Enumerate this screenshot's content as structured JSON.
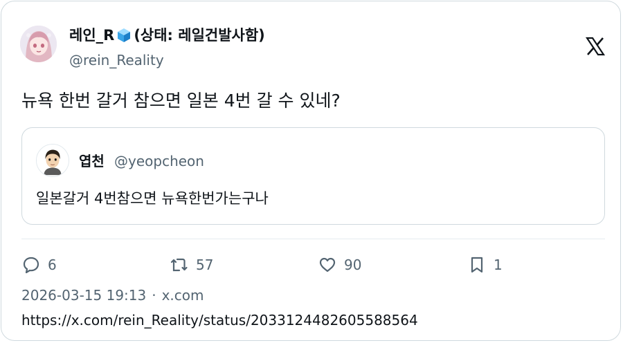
{
  "author": {
    "display_name_prefix": "레인_R",
    "display_name_suffix": "(상태: 레일건발사함)",
    "handle": "@rein_Reality",
    "avatar_icon": "anime-girl-avatar",
    "badge_icon": "blue-cube-icon"
  },
  "brand_icon": "x-logo-icon",
  "tweet": {
    "text": "뉴욕 한번 갈거 참으면 일본 4번 갈 수 있네?"
  },
  "quoted_tweet": {
    "display_name": "엽천",
    "handle": "@yeopcheon",
    "text": "일본갈거 4번참으면 뉴욕한번가는구나",
    "avatar_icon": "mii-avatar"
  },
  "actions": {
    "replies": "6",
    "retweets": "57",
    "likes": "90",
    "bookmarks": "1"
  },
  "meta": {
    "timestamp": "2026-03-15 19:13",
    "separator": "·",
    "source": "x.com"
  },
  "url": "https://x.com/rein_Reality/status/2033124482605588564",
  "colors": {
    "text_primary": "#0f1419",
    "text_secondary": "#536471",
    "border": "#cfd9de"
  }
}
